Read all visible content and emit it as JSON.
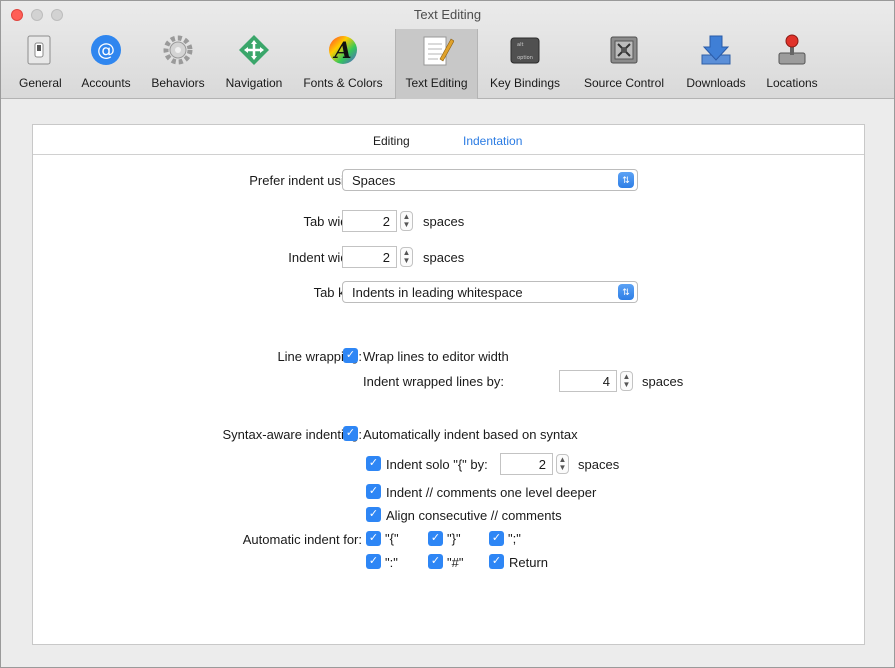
{
  "window": {
    "title": "Text Editing"
  },
  "toolbar": [
    {
      "label": "General",
      "icon": "switch-icon"
    },
    {
      "label": "Accounts",
      "icon": "at-sign-icon"
    },
    {
      "label": "Behaviors",
      "icon": "gear-icon"
    },
    {
      "label": "Navigation",
      "icon": "arrows-icon"
    },
    {
      "label": "Fonts & Colors",
      "icon": "font-color-icon"
    },
    {
      "label": "Text Editing",
      "icon": "pencil-notepad-icon"
    },
    {
      "label": "Key Bindings",
      "icon": "option-key-icon"
    },
    {
      "label": "Source Control",
      "icon": "vault-icon"
    },
    {
      "label": "Downloads",
      "icon": "download-icon"
    },
    {
      "label": "Locations",
      "icon": "joystick-icon"
    }
  ],
  "tabs": {
    "editing": "Editing",
    "indentation": "Indentation"
  },
  "prefs": {
    "prefer_indent_label": "Prefer indent using:",
    "prefer_indent_value": "Spaces",
    "tab_width_label": "Tab width:",
    "tab_width_value": "2",
    "indent_width_label": "Indent width:",
    "indent_width_value": "2",
    "spaces": "spaces",
    "tab_key_label": "Tab key:",
    "tab_key_value": "Indents in leading whitespace",
    "line_wrapping_label": "Line wrapping:",
    "wrap_lines": "Wrap lines to editor width",
    "indent_wrapped_label": "Indent wrapped lines by:",
    "indent_wrapped_value": "4",
    "syntax_label": "Syntax-aware indenting:",
    "auto_indent_syntax": "Automatically indent based on syntax",
    "indent_solo_label": "Indent solo \"{\" by:",
    "indent_solo_value": "2",
    "indent_comments": "Indent // comments one level deeper",
    "align_comments": "Align consecutive // comments",
    "auto_indent_for_label": "Automatic indent for:",
    "auto_chars": [
      "\"{\"",
      "\"}\"",
      "\";\"",
      "\":\"",
      "\"#\"",
      "Return"
    ]
  },
  "colors": {
    "accent": "#2e86f5",
    "link": "#2a7be3"
  }
}
